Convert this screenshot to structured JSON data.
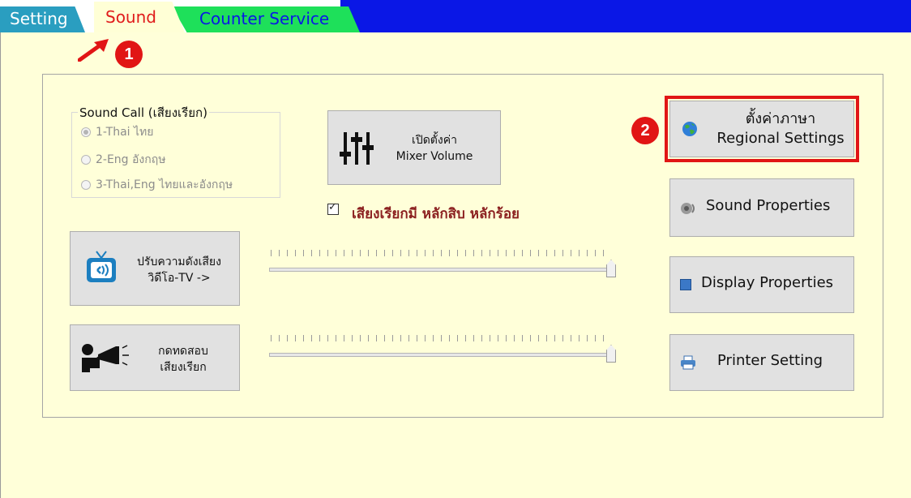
{
  "tabs": [
    {
      "label": "Setting"
    },
    {
      "label": "Sound",
      "active": true
    },
    {
      "label": "Counter Service"
    }
  ],
  "annotations": {
    "badge1": "1",
    "badge2": "2"
  },
  "sound_call": {
    "legend": "Sound Call (เสียงเรียก)",
    "options": [
      {
        "label": "1-Thai ไทย",
        "selected": true
      },
      {
        "label": "2-Eng อังกฤษ",
        "selected": false
      },
      {
        "label": "3-Thai,Eng ไทยและอังกฤษ",
        "selected": false
      }
    ]
  },
  "mixer": {
    "line1": "เปิดตั้งค่า",
    "line2": "Mixer Volume"
  },
  "tens_hundreds": {
    "label": "เสียงเรียกมี หลักสิบ หลักร้อย",
    "checked": true
  },
  "tv_volume": {
    "line1": "ปรับความดังเสียง",
    "line2": "วิดีโอ-TV ->"
  },
  "test_call": {
    "line1": "กดทดสอบ",
    "line2": "เสียงเรียก"
  },
  "sliders": {
    "tv_level": 1.0,
    "call_level": 1.0
  },
  "regional": {
    "line1": "ตั้งค่าภาษา",
    "line2": "Regional Settings"
  },
  "sound_properties": {
    "label": "Sound Properties"
  },
  "display_properties": {
    "label": "Display Properties"
  },
  "printer_setting": {
    "label": "Printer Setting"
  },
  "colors": {
    "active_tab_text": "#e01b1b",
    "annotation_red": "#e11515",
    "header_blue": "#0a17e6",
    "background": "#ffffd9"
  }
}
